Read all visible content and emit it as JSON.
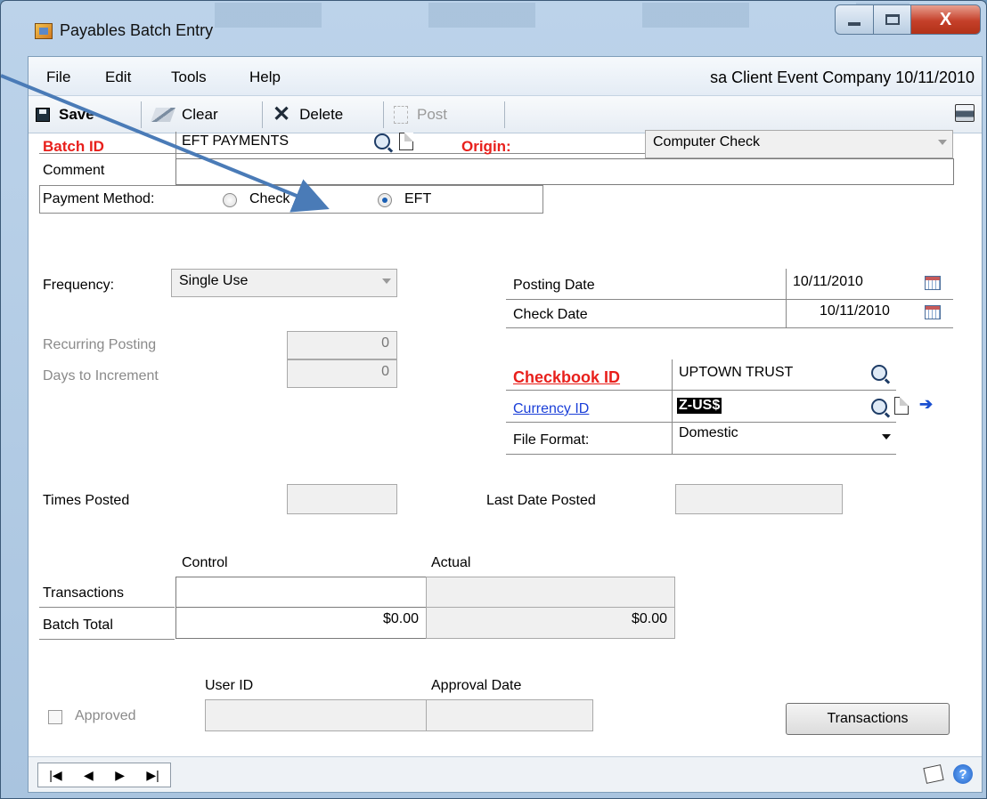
{
  "window": {
    "title": "Payables Batch Entry",
    "close_glyph": "X"
  },
  "menu": {
    "items": [
      "File",
      "Edit",
      "Tools",
      "Help"
    ],
    "status": "sa  Client Event Company  10/11/2010"
  },
  "toolbar": {
    "save": "Save",
    "clear": "Clear",
    "delete": "Delete",
    "post": "Post"
  },
  "form": {
    "batch_id_label": "Batch ID",
    "batch_id": "EFT PAYMENTS",
    "origin_label": "Origin:",
    "origin": "Computer Check",
    "comment_label": "Comment",
    "comment": "",
    "payment_method_label": "Payment Method:",
    "payment_check": "Check",
    "payment_eft": "EFT",
    "payment_selected": "EFT",
    "frequency_label": "Frequency:",
    "frequency": "Single Use",
    "recurring_posting_label": "Recurring Posting",
    "recurring_posting": "0",
    "days_to_increment_label": "Days to Increment",
    "days_to_increment": "0",
    "posting_date_label": "Posting Date",
    "posting_date": "10/11/2010",
    "check_date_label": "Check Date",
    "check_date": "10/11/2010",
    "checkbook_label": "Checkbook ID",
    "checkbook": "UPTOWN TRUST",
    "currency_label": "Currency ID",
    "currency": "Z-US$",
    "file_format_label": "File Format:",
    "file_format": "Domestic",
    "times_posted_label": "Times Posted",
    "times_posted": "",
    "last_date_posted_label": "Last Date Posted",
    "last_date_posted": "",
    "control_header": "Control",
    "actual_header": "Actual",
    "transactions_label": "Transactions",
    "transactions_control": "",
    "transactions_actual": "",
    "batch_total_label": "Batch Total",
    "batch_total_control": "$0.00",
    "batch_total_actual": "$0.00",
    "user_id_label": "User ID",
    "approval_date_label": "Approval Date",
    "approved_label": "Approved",
    "transactions_button": "Transactions"
  },
  "nav": {
    "first": "|◀",
    "prev": "◀",
    "next": "▶",
    "last": "▶|"
  },
  "colors": {
    "required_label": "#e8201c",
    "link": "#1a3fd8",
    "annotation_arrow": "#4a7bb7"
  }
}
